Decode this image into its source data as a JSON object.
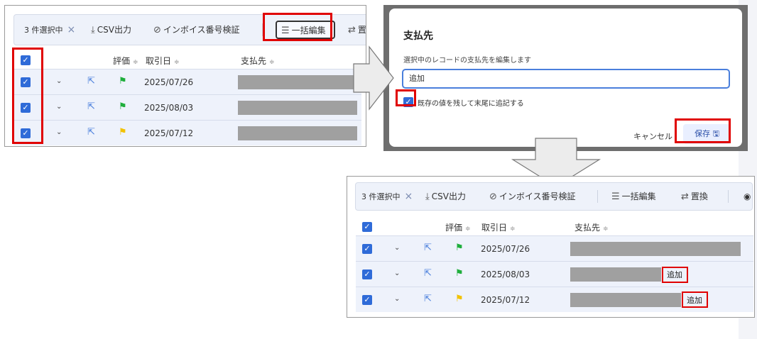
{
  "toolbar": {
    "selected_label": "3 件選択中",
    "clear_label": "×",
    "csv_label": "CSV出力",
    "invoice_label": "インボイス番号検証",
    "bulk_edit_label": "一括編集",
    "replace_label": "置換",
    "replace_label_cut": "置換"
  },
  "headers": {
    "rating": "評価",
    "date": "取引日",
    "payee": "支払先",
    "sort_glyph": "≑"
  },
  "rows": [
    {
      "date": "2025/07/26",
      "flag_color": "#1fae3c"
    },
    {
      "date": "2025/08/03",
      "flag_color": "#1fae3c"
    },
    {
      "date": "2025/07/12",
      "flag_color": "#f2c200"
    }
  ],
  "dialog": {
    "title": "支払先",
    "description": "選択中のレコードの支払先を編集します",
    "input_value": "追加",
    "checkbox_label": "既存の値を残して末尾に追記する",
    "cancel_label": "キャンセル",
    "save_label": "保存"
  },
  "result": {
    "appended_text": "追加"
  },
  "colors": {
    "accent": "#2f6bd8",
    "highlight": "#e00000",
    "redacted": "#a0a0a0"
  }
}
